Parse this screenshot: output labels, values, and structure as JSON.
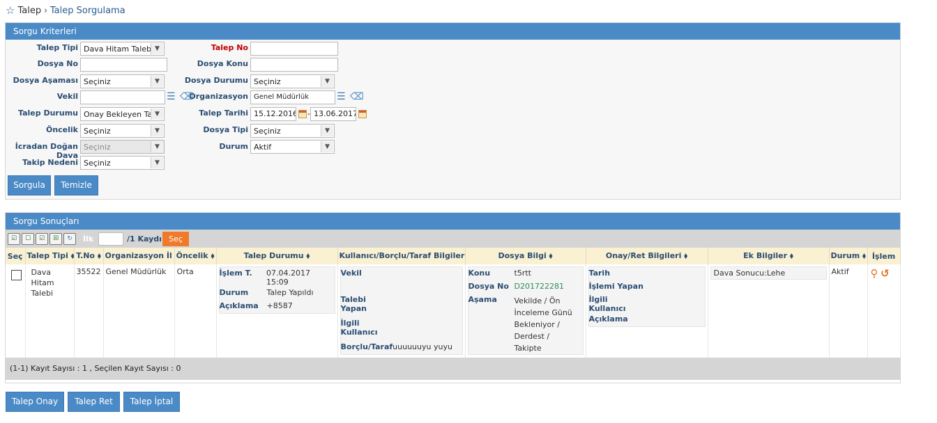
{
  "breadcrumb": {
    "root": "Talep",
    "separator": "›",
    "current": "Talep Sorgulama"
  },
  "criteria": {
    "title": "Sorgu Kriterleri",
    "talep_tipi": {
      "label": "Talep Tipi",
      "value": "Dava Hitam Talebi"
    },
    "talep_no": {
      "label": "Talep No",
      "value": ""
    },
    "dosya_no": {
      "label": "Dosya No",
      "value": ""
    },
    "dosya_konu": {
      "label": "Dosya Konu",
      "value": ""
    },
    "dosya_asamasi": {
      "label": "Dosya Aşaması",
      "value": "Seçiniz"
    },
    "dosya_durumu": {
      "label": "Dosya Durumu",
      "value": "Seçiniz"
    },
    "vekil": {
      "label": "Vekil",
      "value": ""
    },
    "organizasyon": {
      "label": "Organizasyon",
      "value": "Genel Müdürlük"
    },
    "talep_durumu": {
      "label": "Talep Durumu",
      "value": "Onay Bekleyen Tale"
    },
    "talep_tarihi": {
      "label": "Talep Tarihi",
      "from": "15.12.2016",
      "dash": "-",
      "to": "13.06.2017"
    },
    "oncelik": {
      "label": "Öncelik",
      "value": "Seçiniz"
    },
    "dosya_tipi": {
      "label": "Dosya Tipi",
      "value": "Seçiniz"
    },
    "icradan_dogan_dava": {
      "label": "İcradan Doğan Dava",
      "value": "Seçiniz"
    },
    "durum": {
      "label": "Durum",
      "value": "Aktif"
    },
    "takip_nedeni": {
      "label": "Takip Nedeni",
      "value": "Seçiniz"
    },
    "sorgula_button": "Sorgula",
    "temizle_button": "Temizle"
  },
  "results": {
    "title": "Sorgu Sonuçları",
    "pager": {
      "ilk": "İlk",
      "page_value": "",
      "total": "/1 Kaydı",
      "sec_button": "Seç"
    },
    "columns": [
      "Seç",
      "Talep Tipi ⬧",
      "T.No ⬧",
      "Organizasyon İl ⬧",
      "Öncelik ⬧",
      "Talep Durumu ⬧",
      "Kullanıcı/Borçlu/Taraf Bilgileri ⬧",
      "Dosya Bilgi ⬧",
      "Onay/Ret Bilgileri ⬧",
      "Ek Bilgiler ⬧",
      "Durum ⬧",
      "İşlem"
    ],
    "row": {
      "talep_tipi": "Dava Hitam Talebi",
      "t_no": "35522",
      "organizasyon": "Genel Müdürlük",
      "oncelik": "Orta",
      "talep_durumu": {
        "islem_t_label": "İşlem T.",
        "islem_t_value": "07.04.2017 15:09",
        "durum_label": "Durum",
        "durum_value": "Talep Yapıldı",
        "aciklama_label": "Açıklama",
        "aciklama_value": "+8587"
      },
      "kullanici": {
        "vekil_label": "Vekil",
        "vekil_value": "",
        "talebi_yapan_label": "Talebi Yapan",
        "talebi_yapan_value": "",
        "ilgili_kullanici_label": "İlgili Kullanıcı",
        "ilgili_kullanici_value": "",
        "borclu_label": "Borçlu/Taraf",
        "borclu_value": "uuuuuuyu yuyu"
      },
      "dosya_bilgi": {
        "konu_label": "Konu",
        "konu_value": "t5rtt",
        "dosya_no_label": "Dosya No",
        "dosya_no_value": "D201722281",
        "asama_label": "Aşama",
        "asama_value": "Vekilde / Ön İnceleme Günü Bekleniyor / Derdest / Takipte"
      },
      "onay_ret": {
        "tarih_label": "Tarih",
        "islemi_yapan_label": "İşlemi Yapan",
        "ilgili_kullanici_label": "İlgili Kullanıcı",
        "aciklama_label": "Açıklama"
      },
      "ek_bilgiler": "Dava Sonucu:Lehe",
      "durum": "Aktif"
    },
    "footer": "(1-1) Kayıt Sayısı : 1  , Seçilen Kayıt Sayısı : 0"
  },
  "actions": {
    "onay": "Talep Onay",
    "ret": "Talep Ret",
    "iptal": "Talep İptal"
  },
  "colors": {
    "header_blue": "#4a8ac6",
    "accent_orange": "#f07a2a",
    "table_header": "#faf0d2",
    "required_red": "#c00000",
    "dosya_no_green": "#2e8b57"
  }
}
